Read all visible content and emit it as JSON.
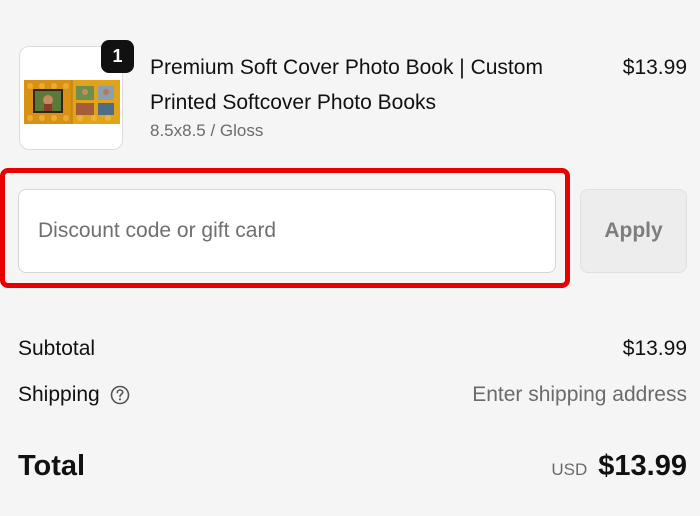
{
  "product": {
    "quantity": "1",
    "title": "Premium Soft Cover Photo Book | Custom Printed Softcover Photo Books",
    "variant": "8.5x8.5 / Gloss",
    "price": "$13.99",
    "thumbnail_icon": "photo-book-thumbnail"
  },
  "discount": {
    "placeholder": "Discount code or gift card",
    "value": "",
    "apply_label": "Apply",
    "highlight_color": "#e60000"
  },
  "summary": {
    "subtotal_label": "Subtotal",
    "subtotal_value": "$13.99",
    "shipping_label": "Shipping",
    "shipping_icon": "question-circle-icon",
    "shipping_value": "Enter shipping address",
    "total_label": "Total",
    "currency": "USD",
    "total_value": "$13.99"
  }
}
